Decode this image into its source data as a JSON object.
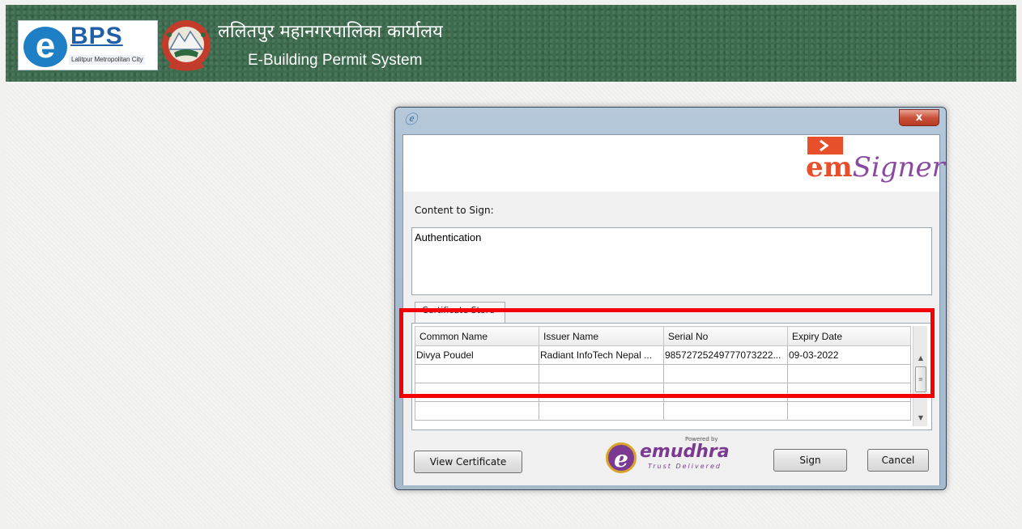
{
  "header": {
    "logo_letter": "e",
    "logo_text": "BPS",
    "logo_sub": "Lalitpur Metropolitan City",
    "title_hindi": "ललितपुर महानगरपालिका कार्यालय",
    "title_english": "E-Building Permit System"
  },
  "dialog": {
    "app_icon": "ie-icon",
    "close_label": "x",
    "brand": {
      "em": "em",
      "signer": "Signer"
    },
    "content_label": "Content to Sign:",
    "content_value": "Authentication",
    "tab_label": "Certificate Store",
    "table": {
      "headers": [
        "Common Name",
        "Issuer Name",
        "Serial No",
        "Expiry Date"
      ],
      "rows": [
        {
          "common_name": "Divya Poudel",
          "issuer_name": "Radiant InfoTech Nepal ...",
          "serial_no": "98572725249777073222...",
          "expiry_date": "09-03-2022"
        }
      ]
    },
    "buttons": {
      "view_certificate": "View Certificate",
      "sign": "Sign",
      "cancel": "Cancel"
    },
    "powered_by": "Powered by",
    "emudhra": "emudhra",
    "emudhra_tag": "Trust Delivered"
  },
  "colors": {
    "header_bg": "#3e6a4e",
    "highlight": "#f40000",
    "emsigner_orange": "#e8502b",
    "emudhra_purple": "#7a3a92"
  }
}
